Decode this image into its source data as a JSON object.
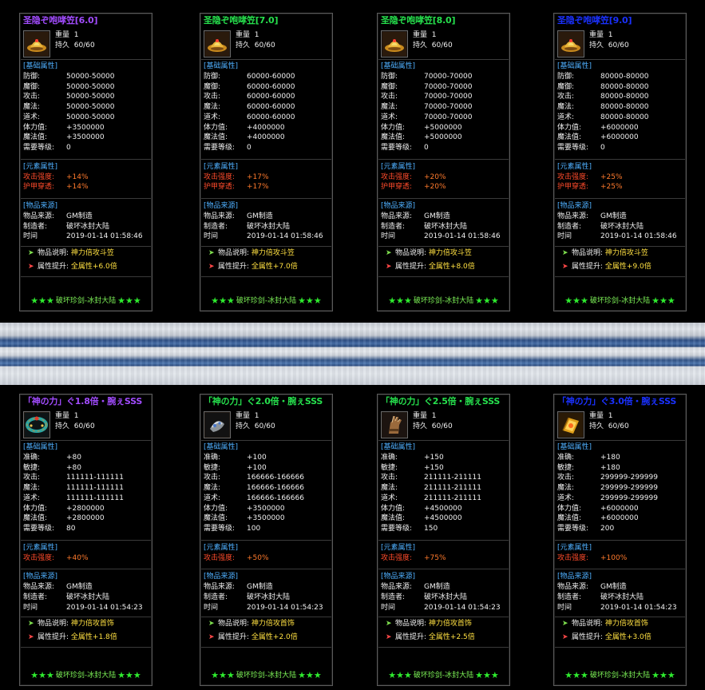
{
  "colors": {
    "title_purple": "#a24cff",
    "title_green": "#26e04d",
    "title_blue": "#1a31ff",
    "section": "#4fb0ff",
    "red_attr": "#ff4b2b",
    "value_yellow": "#ffe042",
    "footer_green": "#7df257"
  },
  "icons": {
    "hat": "golden-hat-icon",
    "bracelet_teal": "teal-bracelet-icon",
    "bracelet_gray": "gray-bracelet-icon",
    "glove": "bone-glove-icon",
    "bracelet_gold": "gold-bracelet-icon",
    "arrow_green": "green-arrow-icon",
    "arrow_red": "red-arrow-icon",
    "star": "green-star-icon"
  },
  "labels": {
    "weight": "重量",
    "durability": "持久",
    "base_section": "[基础属性]",
    "elem_section": "[元素属性]",
    "src_section": "[物品来源]",
    "source_label": "物品来源:",
    "maker_label": "制造者:",
    "time_label": "时间",
    "desc_label": "物品说明:",
    "boost_label": "属性提升:",
    "footer_text": "破坏珍剑-冰封大陆",
    "star": "★"
  },
  "top_cards": [
    {
      "title": "圣隐ぞ咆哮笠[6.0]",
      "title_color": "#a24cff",
      "weight": "1",
      "durability": "60/60",
      "attrs": [
        [
          "防御:",
          "50000-50000"
        ],
        [
          "魔御:",
          "50000-50000"
        ],
        [
          "攻击:",
          "50000-50000"
        ],
        [
          "魔法:",
          "50000-50000"
        ],
        [
          "道术:",
          "50000-50000"
        ],
        [
          "体力值:",
          "+3500000"
        ],
        [
          "魔法值:",
          "+3500000"
        ],
        [
          "需要等级:",
          "0"
        ]
      ],
      "elems": [
        [
          "攻击强度:",
          "+14%"
        ],
        [
          "护甲穿透:",
          "+14%"
        ]
      ],
      "source": "GM制造",
      "maker": "破坏冰封大陆",
      "time": "2019-01-14 01:58:46",
      "desc": "神力倍攻斗笠",
      "boost": "全属性+6.0倍"
    },
    {
      "title": "圣隐ぞ咆哮笠[7.0]",
      "title_color": "#26e04d",
      "weight": "1",
      "durability": "60/60",
      "attrs": [
        [
          "防御:",
          "60000-60000"
        ],
        [
          "魔御:",
          "60000-60000"
        ],
        [
          "攻击:",
          "60000-60000"
        ],
        [
          "魔法:",
          "60000-60000"
        ],
        [
          "道术:",
          "60000-60000"
        ],
        [
          "体力值:",
          "+4000000"
        ],
        [
          "魔法值:",
          "+4000000"
        ],
        [
          "需要等级:",
          "0"
        ]
      ],
      "elems": [
        [
          "攻击强度:",
          "+17%"
        ],
        [
          "护甲穿透:",
          "+17%"
        ]
      ],
      "source": "GM制造",
      "maker": "破坏冰封大陆",
      "time": "2019-01-14 01:58:46",
      "desc": "神力倍攻斗笠",
      "boost": "全属性+7.0倍"
    },
    {
      "title": "圣隐ぞ咆哮笠[8.0]",
      "title_color": "#26e04d",
      "weight": "1",
      "durability": "60/60",
      "attrs": [
        [
          "防御:",
          "70000-70000"
        ],
        [
          "魔御:",
          "70000-70000"
        ],
        [
          "攻击:",
          "70000-70000"
        ],
        [
          "魔法:",
          "70000-70000"
        ],
        [
          "道术:",
          "70000-70000"
        ],
        [
          "体力值:",
          "+5000000"
        ],
        [
          "魔法值:",
          "+5000000"
        ],
        [
          "需要等级:",
          "0"
        ]
      ],
      "elems": [
        [
          "攻击强度:",
          "+20%"
        ],
        [
          "护甲穿透:",
          "+20%"
        ]
      ],
      "source": "GM制造",
      "maker": "破坏冰封大陆",
      "time": "2019-01-14 01:58:46",
      "desc": "神力倍攻斗笠",
      "boost": "全属性+8.0倍"
    },
    {
      "title": "圣隐ぞ咆哮笠[9.0]",
      "title_color": "#1a31ff",
      "weight": "1",
      "durability": "60/60",
      "attrs": [
        [
          "防御:",
          "80000-80000"
        ],
        [
          "魔御:",
          "80000-80000"
        ],
        [
          "攻击:",
          "80000-80000"
        ],
        [
          "魔法:",
          "80000-80000"
        ],
        [
          "道术:",
          "80000-80000"
        ],
        [
          "体力值:",
          "+6000000"
        ],
        [
          "魔法值:",
          "+6000000"
        ],
        [
          "需要等级:",
          "0"
        ]
      ],
      "elems": [
        [
          "攻击强度:",
          "+25%"
        ],
        [
          "护甲穿透:",
          "+25%"
        ]
      ],
      "source": "GM制造",
      "maker": "破坏冰封大陆",
      "time": "2019-01-14 01:58:46",
      "desc": "神力倍攻斗笠",
      "boost": "全属性+9.0倍"
    }
  ],
  "bottom_cards": [
    {
      "title": "「神の力」ぐ1.8倍・腕ぇSSS",
      "title_color": "#a24cff",
      "weight": "1",
      "durability": "60/60",
      "attrs": [
        [
          "准确:",
          "+80"
        ],
        [
          "敏捷:",
          "+80"
        ],
        [
          "攻击:",
          "111111-111111"
        ],
        [
          "魔法:",
          "111111-111111"
        ],
        [
          "道术:",
          "111111-111111"
        ],
        [
          "体力值:",
          "+2800000"
        ],
        [
          "魔法值:",
          "+2800000"
        ],
        [
          "需要等级:",
          "80"
        ]
      ],
      "elems": [
        [
          "攻击强度:",
          "+40%"
        ]
      ],
      "source": "GM制造",
      "maker": "破坏冰封大陆",
      "time": "2019-01-14 01:54:23",
      "desc": "神力倍攻首饰",
      "boost": "全属性+1.8倍"
    },
    {
      "title": "「神の力」ぐ2.0倍・腕ぇSSS",
      "title_color": "#26e04d",
      "weight": "1",
      "durability": "60/60",
      "attrs": [
        [
          "准确:",
          "+100"
        ],
        [
          "敏捷:",
          "+100"
        ],
        [
          "攻击:",
          "166666-166666"
        ],
        [
          "魔法:",
          "166666-166666"
        ],
        [
          "道术:",
          "166666-166666"
        ],
        [
          "体力值:",
          "+3500000"
        ],
        [
          "魔法值:",
          "+3500000"
        ],
        [
          "需要等级:",
          "100"
        ]
      ],
      "elems": [
        [
          "攻击强度:",
          "+50%"
        ]
      ],
      "source": "GM制造",
      "maker": "破坏冰封大陆",
      "time": "2019-01-14 01:54:23",
      "desc": "神力倍攻首饰",
      "boost": "全属性+2.0倍"
    },
    {
      "title": "「神の力」ぐ2.5倍・腕ぇSSS",
      "title_color": "#26e04d",
      "weight": "1",
      "durability": "60/60",
      "attrs": [
        [
          "准确:",
          "+150"
        ],
        [
          "敏捷:",
          "+150"
        ],
        [
          "攻击:",
          "211111-211111"
        ],
        [
          "魔法:",
          "211111-211111"
        ],
        [
          "道术:",
          "211111-211111"
        ],
        [
          "体力值:",
          "+4500000"
        ],
        [
          "魔法值:",
          "+4500000"
        ],
        [
          "需要等级:",
          "150"
        ]
      ],
      "elems": [
        [
          "攻击强度:",
          "+75%"
        ]
      ],
      "source": "GM制造",
      "maker": "破坏冰封大陆",
      "time": "2019-01-14 01:54:23",
      "desc": "神力倍攻首饰",
      "boost": "全属性+2.5倍"
    },
    {
      "title": "「神の力」ぐ3.0倍・腕ぇSSS",
      "title_color": "#1a31ff",
      "weight": "1",
      "durability": "60/60",
      "attrs": [
        [
          "准确:",
          "+180"
        ],
        [
          "敏捷:",
          "+180"
        ],
        [
          "攻击:",
          "299999-299999"
        ],
        [
          "魔法:",
          "299999-299999"
        ],
        [
          "道术:",
          "299999-299999"
        ],
        [
          "体力值:",
          "+6000000"
        ],
        [
          "魔法值:",
          "+6000000"
        ],
        [
          "需要等级:",
          "200"
        ]
      ],
      "elems": [
        [
          "攻击强度:",
          "+100%"
        ]
      ],
      "source": "GM制造",
      "maker": "破坏冰封大陆",
      "time": "2019-01-14 01:54:23",
      "desc": "神力倍攻首饰",
      "boost": "全属性+3.0倍"
    }
  ]
}
